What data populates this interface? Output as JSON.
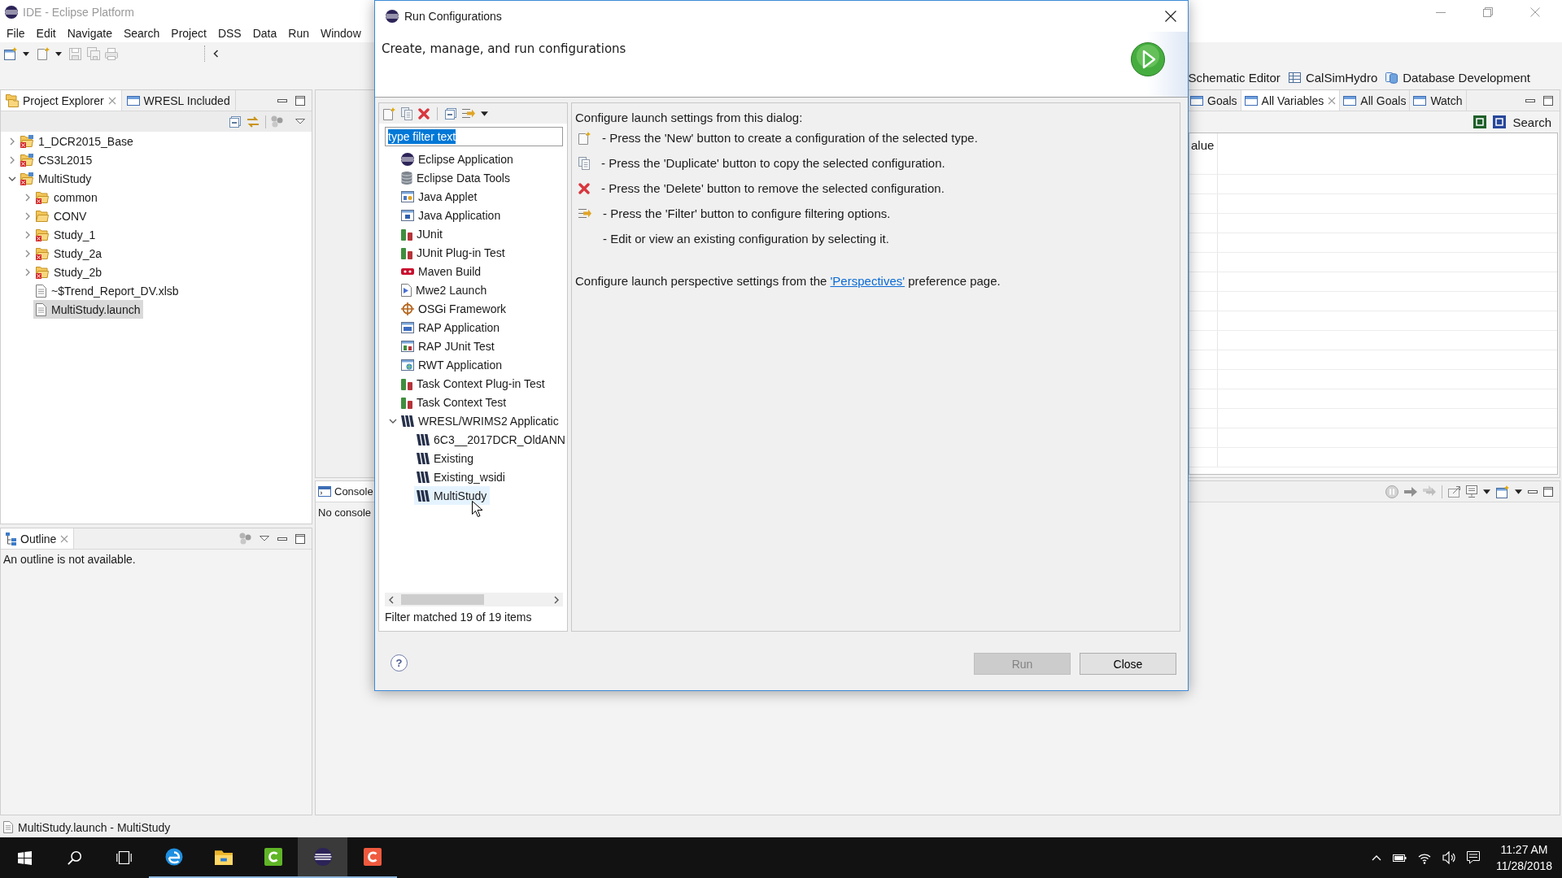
{
  "window": {
    "title": "IDE - Eclipse Platform"
  },
  "menu": [
    "File",
    "Edit",
    "Navigate",
    "Search",
    "Project",
    "DSS",
    "Data",
    "Run",
    "Window"
  ],
  "perspectives": [
    {
      "label": "Schematic Editor",
      "kind": "none"
    },
    {
      "label": "CalSimHydro",
      "kind": "grid"
    },
    {
      "label": "Database Development",
      "kind": "database"
    }
  ],
  "project_explorer": {
    "tabs": [
      {
        "label": "Project Explorer",
        "kind": "explorer",
        "selected": true
      },
      {
        "label": "WRESL Included",
        "kind": "view",
        "selected": false
      }
    ],
    "tree": [
      {
        "label": "1_DCR2015_Base",
        "kind": "project",
        "error": true,
        "expanded": false,
        "selected": false
      },
      {
        "label": "CS3L2015",
        "kind": "project",
        "error": true,
        "expanded": false,
        "selected": false
      },
      {
        "label": "MultiStudy",
        "kind": "project",
        "error": true,
        "expanded": true,
        "selected": false,
        "children": [
          {
            "label": "common",
            "kind": "folder",
            "error": true,
            "expanded": false,
            "selected": false
          },
          {
            "label": "CONV",
            "kind": "folder",
            "error": false,
            "expanded": false,
            "selected": false
          },
          {
            "label": "Study_1",
            "kind": "folder",
            "error": true,
            "expanded": false,
            "selected": false
          },
          {
            "label": "Study_2a",
            "kind": "folder",
            "error": true,
            "expanded": false,
            "selected": false
          },
          {
            "label": "Study_2b",
            "kind": "folder",
            "error": true,
            "expanded": false,
            "selected": false
          },
          {
            "label": "~$Trend_Report_DV.xlsb",
            "kind": "file",
            "error": false,
            "selected": false
          },
          {
            "label": "MultiStudy.launch",
            "kind": "file",
            "error": false,
            "selected": true
          }
        ]
      }
    ]
  },
  "outline": {
    "tab": "Outline",
    "message": "An outline is not available."
  },
  "console": {
    "tab": "Console",
    "message": "No console"
  },
  "variables": {
    "tabs": [
      {
        "label": "Goals",
        "selected": false
      },
      {
        "label": "All Variables",
        "selected": true
      },
      {
        "label": "All Goals",
        "selected": false
      },
      {
        "label": "Watch",
        "selected": false
      }
    ],
    "search": "Search",
    "column_1": "alue"
  },
  "status_bar": {
    "text": "MultiStudy.launch - MultiStudy"
  },
  "dialog": {
    "title": "Run Configurations",
    "heading": "Create, manage, and run configurations",
    "filter": {
      "value": "type filter text",
      "highlighted": true
    },
    "tree": [
      {
        "label": "Eclipse Application",
        "kind": "eclipse",
        "hovered": false
      },
      {
        "label": "Eclipse Data Tools",
        "kind": "database",
        "hovered": false
      },
      {
        "label": "Java Applet",
        "kind": "applet",
        "hovered": false
      },
      {
        "label": "Java Application",
        "kind": "javaapp",
        "hovered": false
      },
      {
        "label": "JUnit",
        "kind": "junit",
        "hovered": false
      },
      {
        "label": "JUnit Plug-in Test",
        "kind": "junit",
        "hovered": false
      },
      {
        "label": "Maven Build",
        "kind": "maven",
        "hovered": false
      },
      {
        "label": "Mwe2 Launch",
        "kind": "mwe2",
        "hovered": false
      },
      {
        "label": "OSGi Framework",
        "kind": "osgi",
        "hovered": false
      },
      {
        "label": "RAP Application",
        "kind": "rap",
        "hovered": false
      },
      {
        "label": "RAP JUnit Test",
        "kind": "rapjunit",
        "hovered": false
      },
      {
        "label": "RWT Application",
        "kind": "rwt",
        "hovered": false
      },
      {
        "label": "Task Context Plug-in Test",
        "kind": "junit",
        "hovered": false
      },
      {
        "label": "Task Context Test",
        "kind": "junit",
        "hovered": false
      },
      {
        "label": "WRESL/WRIMS2 Applicatic",
        "kind": "wresl",
        "hovered": false,
        "expanded": true,
        "children": [
          {
            "label": "6C3__2017DCR_OldANN",
            "kind": "wresl",
            "hovered": false
          },
          {
            "label": "Existing",
            "kind": "wresl",
            "hovered": false
          },
          {
            "label": "Existing_wsidi",
            "kind": "wresl",
            "hovered": false
          },
          {
            "label": "MultiStudy",
            "kind": "wresl",
            "hovered": true
          }
        ]
      }
    ],
    "filter_status": "Filter matched 19 of 19 items",
    "intro": "Configure launch settings from this dialog:",
    "hints": [
      {
        "kind": "new",
        "text": "- Press the 'New' button to create a configuration of the selected type."
      },
      {
        "kind": "duplicate",
        "text": "- Press the 'Duplicate' button to copy the selected configuration."
      },
      {
        "kind": "delete",
        "text": "- Press the 'Delete' button to remove the selected configuration."
      },
      {
        "kind": "filter",
        "text": "- Press the 'Filter' button to configure filtering options."
      },
      {
        "kind": "none",
        "text": "- Edit or view an existing configuration by selecting it."
      }
    ],
    "note": {
      "before": "Configure launch perspective settings from the ",
      "link": "'Perspectives'",
      "after": " preference page."
    },
    "help": "?",
    "buttons": [
      {
        "label": "Run",
        "disabled": true
      },
      {
        "label": "Close",
        "disabled": false
      }
    ]
  },
  "taskbar": {
    "apps": [
      {
        "kind": "edge",
        "running": true,
        "active": false
      },
      {
        "kind": "explorer",
        "running": true,
        "active": false
      },
      {
        "kind": "greenc",
        "running": true,
        "active": false
      },
      {
        "kind": "eclipse",
        "running": true,
        "active": true
      },
      {
        "kind": "redc",
        "running": true,
        "active": false
      }
    ],
    "time": "11:27 AM",
    "date": "11/28/2018"
  }
}
